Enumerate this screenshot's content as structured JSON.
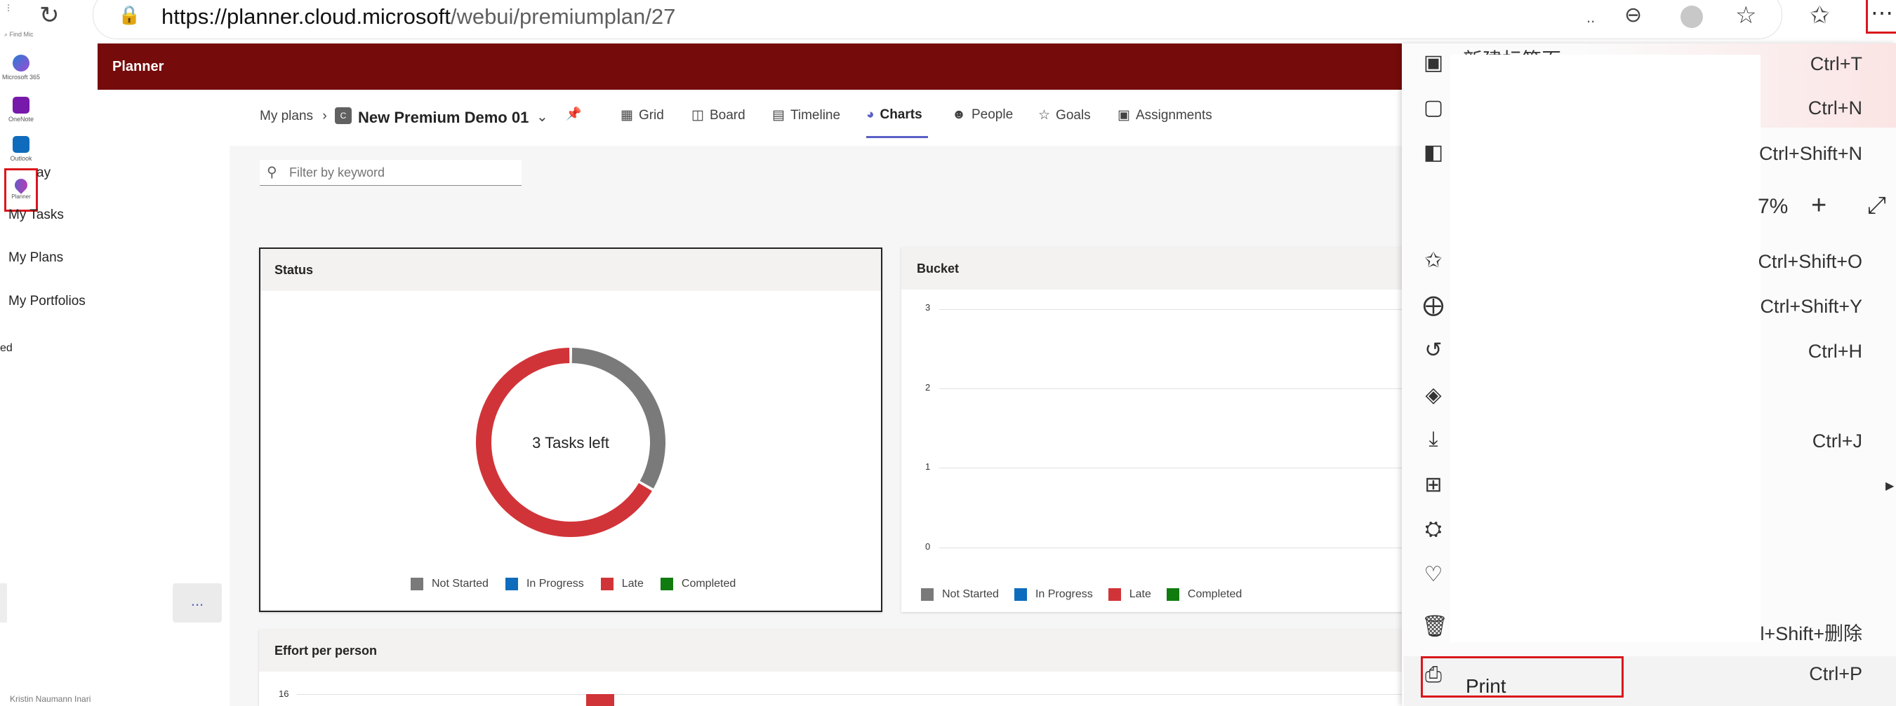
{
  "browser": {
    "url_host": "https://planner.cloud.microsoft",
    "url_path": "/webui/premiumplan/27",
    "overflow_dots": "..",
    "icons": [
      "refresh-icon",
      "lock-icon",
      "zoom-out-icon",
      "edge-icon",
      "favorite-star-icon",
      "favorites-list-icon",
      "more-icon"
    ]
  },
  "rail": {
    "search_text": "Find Mic",
    "apps": [
      {
        "label": "Microsoft 365",
        "icon": "m365-icon"
      },
      {
        "label": "OneNote",
        "icon": "onenote-icon"
      },
      {
        "label": "Outlook",
        "icon": "outlook-icon"
      },
      {
        "label": "Planner",
        "icon": "planner-icon"
      }
    ]
  },
  "left_nav": {
    "items": [
      "ay",
      "My Tasks",
      "My Plans",
      "My Portfolios",
      "ed"
    ],
    "more_label": "...",
    "bottom_text": "Kristin Naumann Inari"
  },
  "planner": {
    "app_title": "Planner",
    "breadcrumb_root": "My plans",
    "plan_badge": "C",
    "plan_name": "New Premium Demo 01",
    "tabs": [
      "Grid",
      "Board",
      "Timeline",
      "Charts",
      "People",
      "Goals",
      "Assignments"
    ],
    "active_tab": "Charts",
    "filter_placeholder": "Filter by keyword"
  },
  "status_card": {
    "title": "Status",
    "center_text": "3 Tasks left",
    "legend": [
      "Not Started",
      "In Progress",
      "Late",
      "Completed"
    ]
  },
  "bucket_card": {
    "title": "Bucket",
    "legend": [
      "Not Started",
      "In Progress",
      "Late",
      "Completed"
    ]
  },
  "effort_card": {
    "title": "Effort per person",
    "y_top_label": "16"
  },
  "colors": {
    "not_started": "#7a7a7a",
    "in_progress": "#0f6cbd",
    "late": "#d13438",
    "completed": "#107c10",
    "header": "#750b0b",
    "highlight": "#d9171c"
  },
  "chart_data": [
    {
      "type": "pie",
      "title": "Status",
      "categories": [
        "Not Started",
        "In Progress",
        "Late",
        "Completed"
      ],
      "values": [
        1,
        0,
        2,
        0
      ]
    },
    {
      "type": "bar",
      "title": "Bucket",
      "categories": [],
      "yticks": [
        0,
        1,
        2,
        3
      ],
      "ylim": [
        0,
        3
      ],
      "series": [
        {
          "name": "Not Started",
          "values": []
        },
        {
          "name": "In Progress",
          "values": []
        },
        {
          "name": "Late",
          "values": []
        },
        {
          "name": "Completed",
          "values": []
        }
      ]
    }
  ],
  "menu": {
    "title_text": "新建标签页",
    "zoom_text": "7%",
    "items": [
      {
        "icon": "new-tab-icon",
        "shortcut": "Ctrl+T"
      },
      {
        "icon": "new-window-icon",
        "shortcut": "Ctrl+N"
      },
      {
        "icon": "inprivate-window-icon",
        "shortcut": "Ctrl+Shift+N"
      },
      {
        "icon": "favorites-icon",
        "shortcut": "Ctrl+Shift+O"
      },
      {
        "icon": "collections-icon",
        "shortcut": "Ctrl+Shift+Y"
      },
      {
        "icon": "history-icon",
        "shortcut": "Ctrl+H"
      },
      {
        "icon": "shopping-tag-icon",
        "shortcut": ""
      },
      {
        "icon": "downloads-icon",
        "shortcut": "Ctrl+J"
      },
      {
        "icon": "apps-icon",
        "shortcut": ""
      },
      {
        "icon": "extensions-icon",
        "shortcut": ""
      },
      {
        "icon": "browser-essentials-icon",
        "shortcut": ""
      },
      {
        "icon": "delete-browsing-data-icon",
        "shortcut": "l+Shift+删除"
      },
      {
        "icon": "print-icon",
        "shortcut": "Ctrl+P"
      }
    ],
    "print_label": "Print",
    "plus": "+",
    "arrow": "▶"
  }
}
